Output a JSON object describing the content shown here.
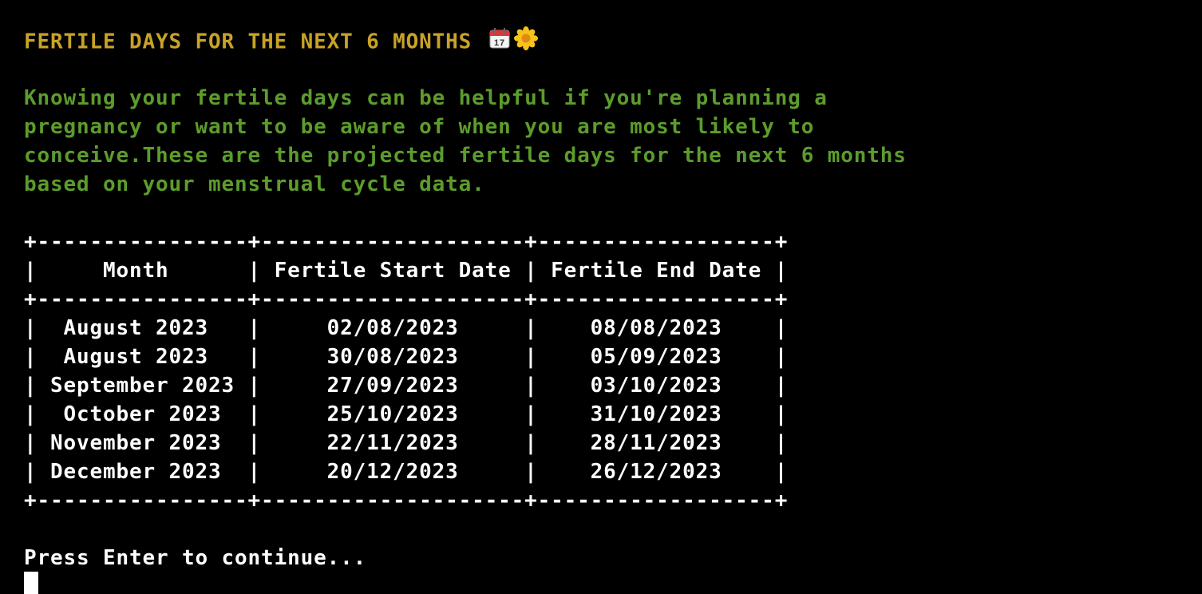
{
  "title": {
    "text": "FERTILE DAYS FOR THE NEXT 6 MONTHS",
    "icons": [
      "calendar-icon",
      "blossom-icon"
    ]
  },
  "intro": {
    "lines": [
      "Knowing your fertile days can be helpful if you're planning a",
      "pregnancy or want to be aware of when you are most likely to",
      "conceive.These are the projected fertile days for the next 6 months",
      "based on your menstrual cycle data."
    ]
  },
  "table": {
    "border": "+----------------+--------------------+------------------+",
    "header": "|     Month      | Fertile Start Date | Fertile End Date |",
    "columns": [
      "Month",
      "Fertile Start Date",
      "Fertile End Date"
    ],
    "rows": [
      {
        "month": "August 2023",
        "start": "02/08/2023",
        "end": "08/08/2023",
        "line": "|  August 2023   |     02/08/2023     |    08/08/2023    |"
      },
      {
        "month": "August 2023",
        "start": "30/08/2023",
        "end": "05/09/2023",
        "line": "|  August 2023   |     30/08/2023     |    05/09/2023    |"
      },
      {
        "month": "September 2023",
        "start": "27/09/2023",
        "end": "03/10/2023",
        "line": "| September 2023 |     27/09/2023     |    03/10/2023    |"
      },
      {
        "month": "October 2023",
        "start": "25/10/2023",
        "end": "31/10/2023",
        "line": "|  October 2023  |     25/10/2023     |    31/10/2023    |"
      },
      {
        "month": "November 2023",
        "start": "22/11/2023",
        "end": "28/11/2023",
        "line": "| November 2023  |     22/11/2023     |    28/11/2023    |"
      },
      {
        "month": "December 2023",
        "start": "20/12/2023",
        "end": "26/12/2023",
        "line": "| December 2023  |     20/12/2023     |    26/12/2023    |"
      }
    ]
  },
  "prompt": {
    "text": "Press Enter to continue..."
  },
  "colors": {
    "background": "#000000",
    "title": "#c9a227",
    "intro": "#5c9c2c",
    "table": "#ffffff",
    "prompt": "#ffffff"
  }
}
